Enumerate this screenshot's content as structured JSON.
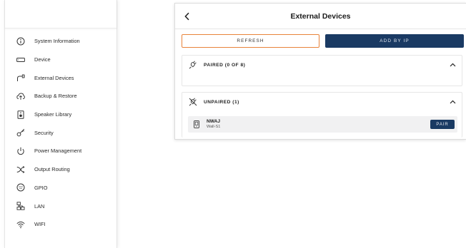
{
  "menu": {
    "items": [
      {
        "label": "System Information",
        "icon": "info-icon"
      },
      {
        "label": "Device",
        "icon": "device-icon"
      },
      {
        "label": "External Devices",
        "icon": "external-devices-icon"
      },
      {
        "label": "Backup & Restore",
        "icon": "backup-restore-icon"
      },
      {
        "label": "Speaker Library",
        "icon": "speaker-icon"
      },
      {
        "label": "Security",
        "icon": "key-icon"
      },
      {
        "label": "Power Management",
        "icon": "power-icon"
      },
      {
        "label": "Output Routing",
        "icon": "routing-icon"
      },
      {
        "label": "GPIO",
        "icon": "gpio-icon"
      },
      {
        "label": "LAN",
        "icon": "lan-icon"
      },
      {
        "label": "WIFI",
        "icon": "wifi-icon"
      }
    ]
  },
  "panel": {
    "title": "External Devices",
    "refresh_label": "REFRESH",
    "add_by_ip_label": "ADD BY IP",
    "paired": {
      "label": "PAIRED (0 OF 8)"
    },
    "unpaired": {
      "label": "UNPAIRED (1)",
      "devices": [
        {
          "name": "NWAJ",
          "model": "Wall-S1",
          "action_label": "PAIR"
        }
      ]
    }
  },
  "colors": {
    "accent_orange": "#e8833a",
    "primary_navy": "#1a3a63",
    "row_background": "#f1f1f2"
  }
}
